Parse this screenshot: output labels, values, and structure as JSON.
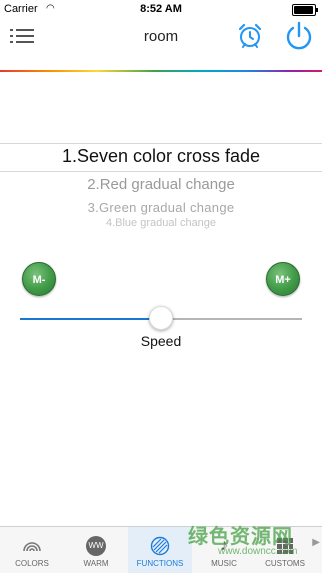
{
  "status_bar": {
    "carrier": "Carrier",
    "time": "8:52 AM"
  },
  "nav": {
    "title": "room"
  },
  "picker": {
    "selected": "1.Seven color cross fade",
    "options": [
      "2.Red gradual change",
      "3.Green gradual change",
      "4.Blue gradual change"
    ]
  },
  "controls": {
    "m_minus": "M-",
    "m_plus": "M+",
    "speed_label": "Speed",
    "speed_value": 0.5
  },
  "tabs": [
    {
      "label": "COLORS",
      "icon": "rainbow-icon",
      "active": false
    },
    {
      "label": "WARM",
      "icon": "ww-icon",
      "icon_text": "WW",
      "active": false
    },
    {
      "label": "FUNCTIONS",
      "icon": "functions-icon",
      "active": true
    },
    {
      "label": "MUSIC",
      "icon": "music-icon",
      "active": false
    },
    {
      "label": "CUSTOMS",
      "icon": "customs-icon",
      "active": false
    }
  ],
  "colors": {
    "accent": "#1e7bd8",
    "mode_button": "#3f9a47"
  },
  "watermark": {
    "text": "绿色资源网",
    "url": "www.downcc.com"
  }
}
